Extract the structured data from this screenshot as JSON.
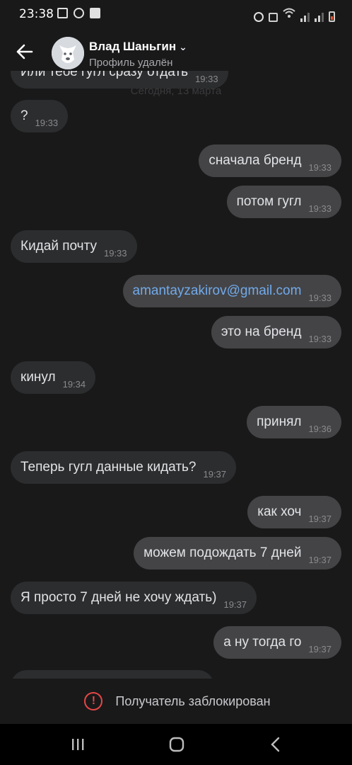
{
  "status_bar": {
    "time": "23:38"
  },
  "header": {
    "name": "Влад Шаньгин",
    "status": "Профиль удалён"
  },
  "partial": {
    "top_text": "Или тебе гугл сразу отдать",
    "top_time": "19:33",
    "date_behind": "Сегодня, 13 марта"
  },
  "messages": [
    {
      "dir": "in",
      "text": "?",
      "time": "19:33"
    },
    {
      "dir": "out",
      "text": "сначала бренд",
      "time": "19:33"
    },
    {
      "dir": "out",
      "text": "потом гугл",
      "time": "19:33"
    },
    {
      "dir": "in",
      "text": "Кидай почту",
      "time": "19:33"
    },
    {
      "dir": "out",
      "text": "amantayzakirov@gmail.com",
      "time": "19:33",
      "link": true
    },
    {
      "dir": "out",
      "text": "это на бренд",
      "time": "19:33"
    },
    {
      "dir": "in",
      "text": "кинул",
      "time": "19:34"
    },
    {
      "dir": "out",
      "text": "принял",
      "time": "19:36"
    },
    {
      "dir": "in",
      "text": "Теперь гугл данные кидать?",
      "time": "19:37"
    },
    {
      "dir": "out",
      "text": "как хоч",
      "time": "19:37"
    },
    {
      "dir": "out",
      "text": "можем подождать 7 дней",
      "time": "19:37"
    },
    {
      "dir": "in",
      "text": "Я просто 7 дней не хочу ждать)",
      "time": "19:37"
    },
    {
      "dir": "out",
      "text": "а ну тогда го",
      "time": "19:37"
    }
  ],
  "blocked": {
    "text": "Получатель заблокирован",
    "icon": "alert-circle-icon",
    "color": "#e64646"
  },
  "nav": {
    "icons": [
      "recent-apps-icon",
      "home-icon",
      "back-nav-icon"
    ]
  }
}
